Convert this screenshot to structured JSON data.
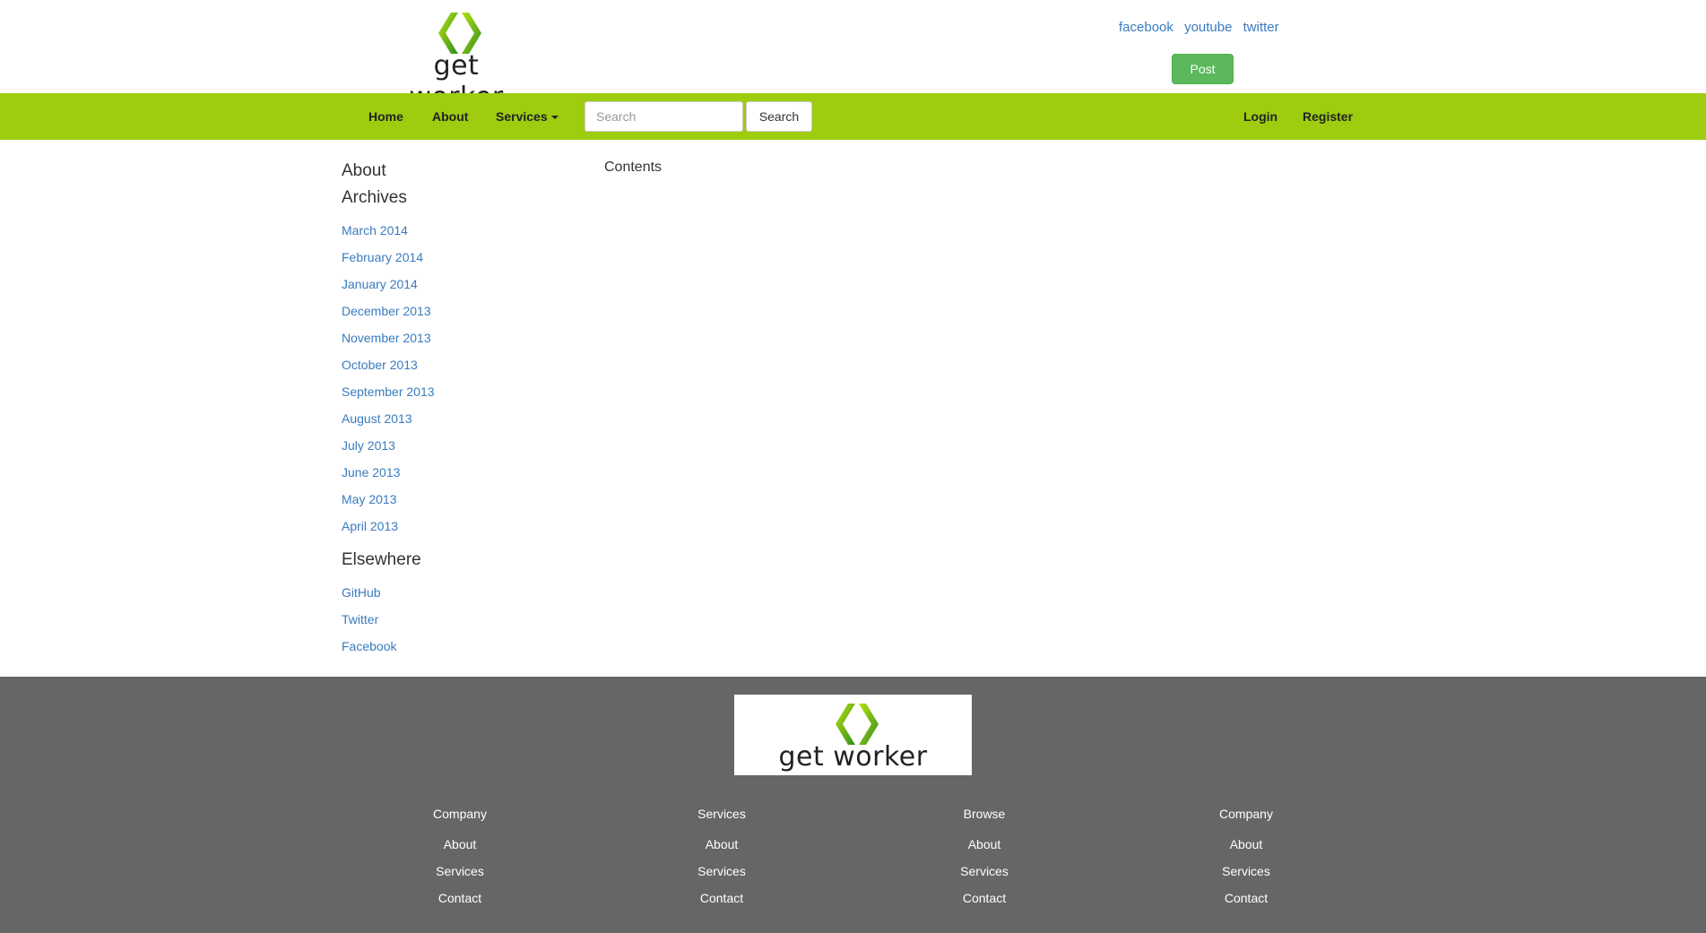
{
  "brand": {
    "name": "get worker",
    "colors": {
      "green": "#9dcd0e",
      "dark_green": "#2f8f1f",
      "footer_gray": "#666666",
      "link_blue": "#3a7bbf",
      "post_green": "#5cb85c"
    }
  },
  "header": {
    "social": [
      {
        "label": "facebook"
      },
      {
        "label": "youtube"
      },
      {
        "label": "twitter"
      }
    ],
    "post_label": "Post"
  },
  "nav": {
    "home": "Home",
    "about": "About",
    "services": "Services",
    "search_placeholder": "Search",
    "search_button": "Search",
    "login": "Login",
    "register": "Register"
  },
  "sidebar": {
    "about_title": "About",
    "archives_title": "Archives",
    "archives": [
      "March 2014",
      "February 2014",
      "January 2014",
      "December 2013",
      "November 2013",
      "October 2013",
      "September 2013",
      "August 2013",
      "July 2013",
      "June 2013",
      "May 2013",
      "April 2013"
    ],
    "elsewhere_title": "Elsewhere",
    "elsewhere": [
      "GitHub",
      "Twitter",
      "Facebook"
    ]
  },
  "main": {
    "contents_title": "Contents"
  },
  "footer": {
    "columns": [
      {
        "title": "Company",
        "links": [
          "About",
          "Services",
          "Contact"
        ]
      },
      {
        "title": "Services",
        "links": [
          "About",
          "Services",
          "Contact"
        ]
      },
      {
        "title": "Browse",
        "links": [
          "About",
          "Services",
          "Contact"
        ]
      },
      {
        "title": "Company",
        "links": [
          "About",
          "Services",
          "Contact"
        ]
      }
    ]
  }
}
